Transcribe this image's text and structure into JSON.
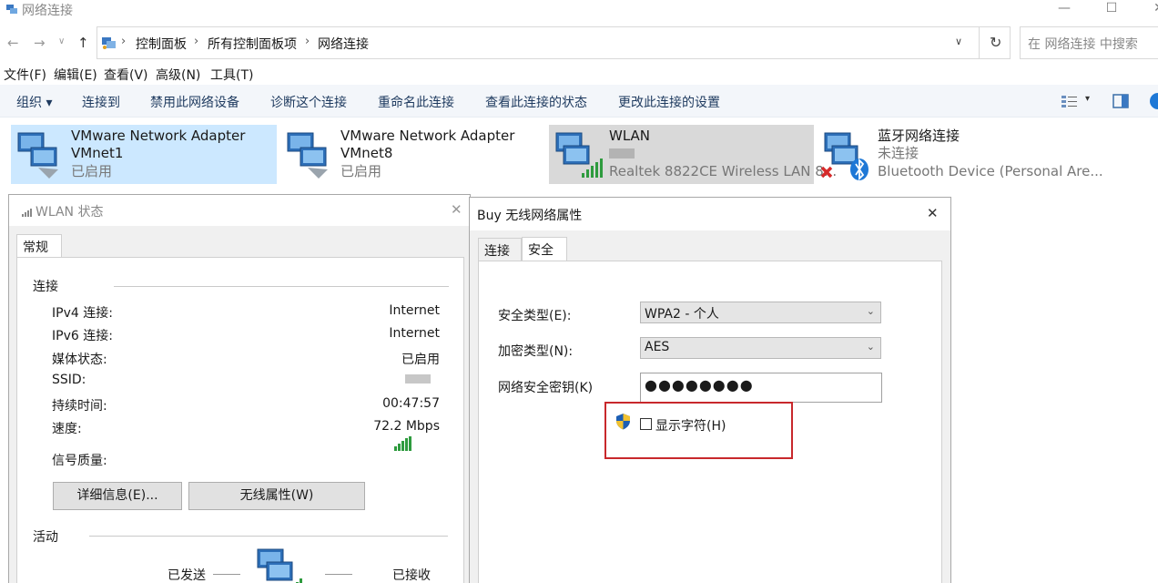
{
  "window": {
    "title": "网络连接",
    "minimize": "—",
    "maximize": "☐",
    "close": "✕"
  },
  "nav": {
    "back": "←",
    "forward": "→",
    "recent": "∨",
    "up": "↑",
    "breadcrumb": [
      "控制面板",
      "所有控制面板项",
      "网络连接"
    ],
    "dropdown": "∨",
    "refresh": "↻",
    "search_placeholder": "在 网络连接 中搜索"
  },
  "menu": [
    "文件(F)",
    "编辑(E)",
    "查看(V)",
    "高级(N)",
    "工具(T)"
  ],
  "commands": [
    "组织 ▾",
    "连接到",
    "禁用此网络设备",
    "诊断这个连接",
    "重命名此连接",
    "查看此连接的状态",
    "更改此连接的设置"
  ],
  "adapters": [
    {
      "name": "VMware Network Adapter",
      "line2": "VMnet1",
      "status": "已启用"
    },
    {
      "name": "VMware Network Adapter",
      "line2": "VMnet8",
      "status": "已启用"
    },
    {
      "name": "WLAN",
      "line2": "",
      "status": "Realtek 8822CE Wireless LAN 8..."
    },
    {
      "name": "蓝牙网络连接",
      "line2": "未连接",
      "status": "Bluetooth Device (Personal Are..."
    }
  ],
  "status_dialog": {
    "title": "WLAN 状态",
    "close": "✕",
    "tab": "常规",
    "section_connection": "连接",
    "rows": [
      {
        "label": "IPv4 连接:",
        "value": "Internet"
      },
      {
        "label": "IPv6 连接:",
        "value": "Internet"
      },
      {
        "label": "媒体状态:",
        "value": "已启用"
      },
      {
        "label": "SSID:",
        "value": ""
      },
      {
        "label": "持续时间:",
        "value": "00:47:57"
      },
      {
        "label": "速度:",
        "value": "72.2 Mbps"
      }
    ],
    "signal_label": "信号质量:",
    "details_button": "详细信息(E)...",
    "wireless_button": "无线属性(W)",
    "section_activity": "活动",
    "sent": "已发送",
    "received": "已接收"
  },
  "props_dialog": {
    "title": "Buy 无线网络属性",
    "close": "✕",
    "tabs": [
      "连接",
      "安全"
    ],
    "security_type_label": "安全类型(E):",
    "security_type_value": "WPA2 - 个人",
    "encryption_type_label": "加密类型(N):",
    "encryption_type_value": "AES",
    "key_label": "网络安全密钥(K)",
    "key_value": "●●●●●●●●",
    "show_chars_label": "显示字符(H)"
  },
  "colors": {
    "highlight_tile": "#cce8ff",
    "selected_tile": "#d9d9d9",
    "annotation_red": "#c8282c",
    "signal_green": "#2e9b3e"
  }
}
